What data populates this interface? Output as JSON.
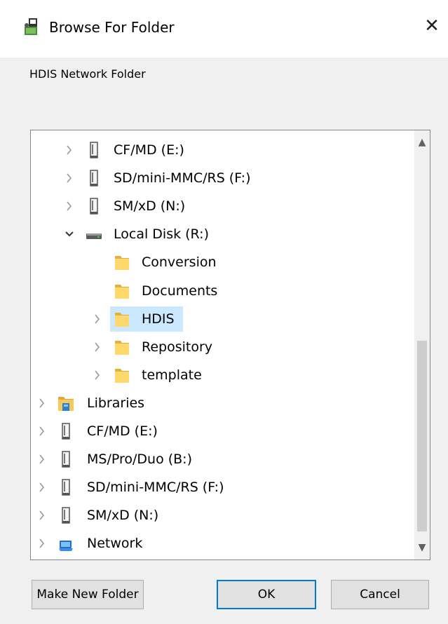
{
  "dialog": {
    "title": "Browse For Folder",
    "close_glyph": "✕",
    "instruction": "HDIS Network Folder"
  },
  "tree": {
    "items": [
      {
        "label": "CF/MD (E:)",
        "icon": "removable-drive-icon",
        "expander": "collapsed"
      },
      {
        "label": "SD/mini-MMC/RS (F:)",
        "icon": "removable-drive-icon",
        "expander": "collapsed"
      },
      {
        "label": "SM/xD (N:)",
        "icon": "removable-drive-icon",
        "expander": "collapsed"
      },
      {
        "label": "Local Disk (R:)",
        "icon": "hard-disk-icon",
        "expander": "expanded"
      },
      {
        "label": "Conversion",
        "icon": "folder-icon",
        "expander": "none"
      },
      {
        "label": "Documents",
        "icon": "folder-icon",
        "expander": "none"
      },
      {
        "label": "HDIS",
        "icon": "folder-icon",
        "expander": "collapsed",
        "selected": true
      },
      {
        "label": "Repository",
        "icon": "folder-icon",
        "expander": "collapsed"
      },
      {
        "label": "template",
        "icon": "folder-icon",
        "expander": "collapsed"
      },
      {
        "label": "Libraries",
        "icon": "libraries-icon",
        "expander": "collapsed"
      },
      {
        "label": "CF/MD (E:)",
        "icon": "removable-drive-icon",
        "expander": "collapsed"
      },
      {
        "label": "MS/Pro/Duo (B:)",
        "icon": "removable-drive-icon",
        "expander": "collapsed"
      },
      {
        "label": "SD/mini-MMC/RS (F:)",
        "icon": "removable-drive-icon",
        "expander": "collapsed"
      },
      {
        "label": "SM/xD (N:)",
        "icon": "removable-drive-icon",
        "expander": "collapsed"
      },
      {
        "label": "Network",
        "icon": "network-icon",
        "expander": "collapsed"
      }
    ]
  },
  "buttons": {
    "make_new_folder": "Make New Folder",
    "ok": "OK",
    "cancel": "Cancel"
  },
  "colors": {
    "selection": "#cce8ff",
    "folder": "#ffd86b",
    "default_button_border": "#0078d7"
  }
}
